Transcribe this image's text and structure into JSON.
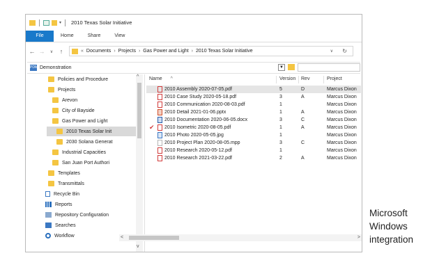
{
  "window": {
    "title": "2010 Texas Solar Initiative"
  },
  "ribbon": {
    "tabs": [
      "File",
      "Home",
      "Share",
      "View"
    ]
  },
  "address_bar": {
    "breadcrumbs": [
      "Documents",
      "Projects",
      "Gas Power and Light",
      "2010 Texas Solar Initiative"
    ],
    "overflow": "«"
  },
  "vault": {
    "icon_text": "PDM",
    "label": "Demonstration"
  },
  "tree": {
    "items": [
      {
        "label": "Policies and Procedure",
        "icon": "folder-icon"
      },
      {
        "label": "Projects",
        "icon": "folder-icon"
      },
      {
        "label": "Arevon",
        "icon": "folder-icon"
      },
      {
        "label": "City of Bayside",
        "icon": "folder-icon"
      },
      {
        "label": "Gas Power and Light",
        "icon": "folder-icon"
      },
      {
        "label": "2010 Texas Solar Init",
        "icon": "folder-icon",
        "selected": true
      },
      {
        "label": "2030 Solana Generat",
        "icon": "folder-icon"
      },
      {
        "label": "Industrial Capacities",
        "icon": "folder-icon"
      },
      {
        "label": "San Juan Port Authori",
        "icon": "folder-icon"
      },
      {
        "label": "Templates",
        "icon": "folder-icon"
      },
      {
        "label": "Transmittals",
        "icon": "folder-icon"
      },
      {
        "label": "Recycle Bin",
        "icon": "recycle-bin-icon"
      },
      {
        "label": "Reports",
        "icon": "reports-icon"
      },
      {
        "label": "Repository Configuration",
        "icon": "settings-icon"
      },
      {
        "label": "Searches",
        "icon": "search-icon"
      },
      {
        "label": "Workflow",
        "icon": "workflow-icon"
      }
    ]
  },
  "file_list": {
    "columns": [
      "Name",
      "Version",
      "Rev",
      "Project Manager"
    ],
    "sort_indicator": "^",
    "rows": [
      {
        "name": "2010 Assembly 2020-07-05.pdf",
        "version": "5",
        "rev": "D",
        "manager": "Marcus Dixon",
        "icon": "pdf-icon",
        "selected": true
      },
      {
        "name": "2010 Case Study 2020-05-18.pdf",
        "version": "3",
        "rev": "A",
        "manager": "Marcus Dixon",
        "icon": "pdf-icon"
      },
      {
        "name": "2010 Communication 2020-08-03.pdf",
        "version": "1",
        "rev": "",
        "manager": "Marcus Dixon",
        "icon": "pdf-icon"
      },
      {
        "name": "2010 Detail 2021-01-06.pptx",
        "version": "1",
        "rev": "A",
        "manager": "Marcus Dixon",
        "icon": "pptx-icon"
      },
      {
        "name": "2010 Documentation 2020-06-05.docx",
        "version": "3",
        "rev": "C",
        "manager": "Marcus Dixon",
        "icon": "docx-icon"
      },
      {
        "name": "2010 Isometric 2020-08-05.pdf",
        "version": "1",
        "rev": "A",
        "manager": "Marcus Dixon",
        "icon": "pdf-icon",
        "checked_out": true
      },
      {
        "name": "2010 Photo 2020-05-05.jpg",
        "version": "1",
        "rev": "",
        "manager": "Marcus Dixon",
        "icon": "jpg-icon"
      },
      {
        "name": "2010 Project Plan 2020-08-05.mpp",
        "version": "3",
        "rev": "C",
        "manager": "Marcus Dixon",
        "icon": "mpp-icon"
      },
      {
        "name": "2010 Research 2020-05-12.pdf",
        "version": "1",
        "rev": "",
        "manager": "Marcus Dixon",
        "icon": "pdf-icon"
      },
      {
        "name": "2010 Research 2021-03-22.pdf",
        "version": "2",
        "rev": "A",
        "manager": "Marcus Dixon",
        "icon": "pdf-icon"
      }
    ]
  },
  "caption": {
    "lines": [
      "Microsoft",
      "Windows",
      "integration"
    ]
  },
  "colors": {
    "file_tab": "#1979ca",
    "folder": "#f4c542",
    "pdf": "#d23b3b"
  }
}
